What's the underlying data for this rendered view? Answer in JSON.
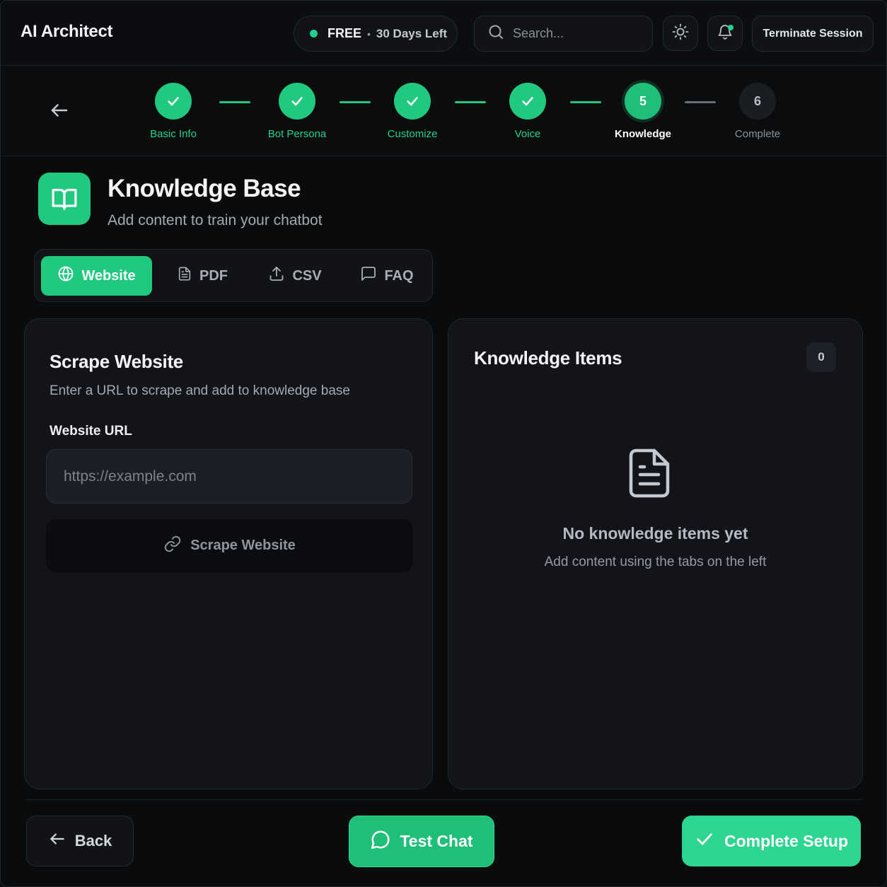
{
  "header": {
    "brand": "AI Architect",
    "plan_name": "FREE",
    "plan_separator": "•",
    "plan_days": "30 Days Left",
    "search_placeholder": "Search...",
    "terminate_label": "Terminate Session"
  },
  "stepper": {
    "steps": [
      {
        "number": "1",
        "label": "Basic Info",
        "state": "done"
      },
      {
        "number": "2",
        "label": "Bot Persona",
        "state": "done"
      },
      {
        "number": "3",
        "label": "Customize",
        "state": "done"
      },
      {
        "number": "4",
        "label": "Voice",
        "state": "done"
      },
      {
        "number": "5",
        "label": "Knowledge",
        "state": "active"
      },
      {
        "number": "6",
        "label": "Complete",
        "state": "pending"
      }
    ]
  },
  "page": {
    "title": "Knowledge Base",
    "subtitle": "Add content to train your chatbot"
  },
  "tabs": [
    {
      "label": "Website",
      "icon": "globe-icon",
      "active": true
    },
    {
      "label": "PDF",
      "icon": "file-text-icon",
      "active": false
    },
    {
      "label": "CSV",
      "icon": "upload-icon",
      "active": false
    },
    {
      "label": "FAQ",
      "icon": "message-square-icon",
      "active": false
    }
  ],
  "scrape_card": {
    "title": "Scrape Website",
    "description": "Enter a URL to scrape and add to knowledge base",
    "field_label": "Website URL",
    "url_placeholder": "https://example.com",
    "url_value": "",
    "button_label": "Scrape Website"
  },
  "knowledge_card": {
    "title": "Knowledge Items",
    "count": "0",
    "empty_title": "No knowledge items yet",
    "empty_description": "Add content using the tabs on the left"
  },
  "footer": {
    "back_label": "Back",
    "test_label": "Test Chat",
    "complete_label": "Complete Setup"
  },
  "colors": {
    "accent": "#21c97f",
    "background": "#0a0b0d",
    "card": "#12141a"
  }
}
